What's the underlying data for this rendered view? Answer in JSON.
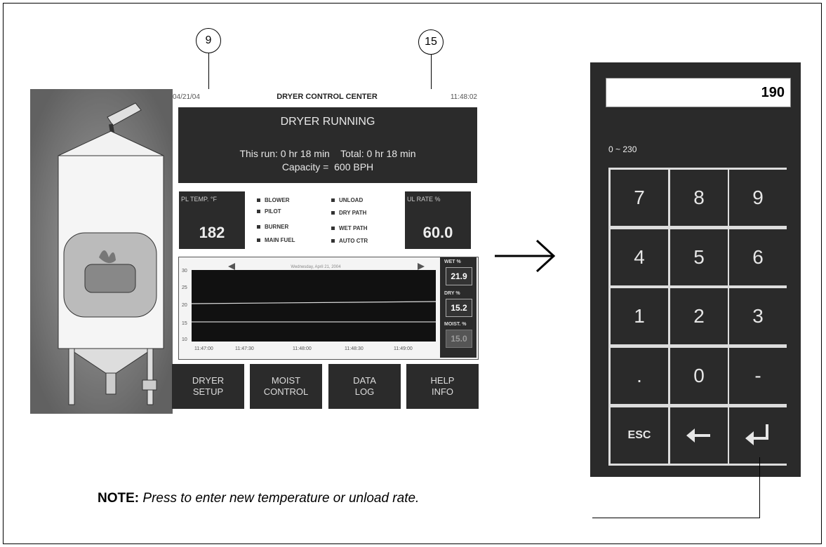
{
  "callouts": {
    "left": "9",
    "right": "15"
  },
  "hmi": {
    "date": "04/21/04",
    "title": "DRYER CONTROL CENTER",
    "time": "11:48:02",
    "status_line": "DRYER RUNNING",
    "run_line": "This run: 0 hr 18 min    Total: 0 hr 18 min",
    "capacity_line": "Capacity =  600 BPH",
    "temp_label": "PL TEMP. °F",
    "temp_value": "182",
    "rate_label": "UL RATE %",
    "rate_value": "60.0",
    "indicators_left": [
      "BLOWER",
      "PILOT",
      "BURNER",
      "MAIN FUEL"
    ],
    "indicators_right": [
      "UNLOAD",
      "DRY PATH",
      "WET PATH",
      "AUTO CTR"
    ],
    "chart": {
      "date_label": "Wednesday, April 21, 2004",
      "y_ticks": [
        "30",
        "25",
        "20",
        "15",
        "10"
      ],
      "x_ticks": [
        "11:47:00",
        "11:47:30",
        "11:48:00",
        "11:48:30",
        "11:49:00"
      ],
      "wet_label": "WET %",
      "wet_value": "21.9",
      "dry_label": "DRY %",
      "dry_value": "15.2",
      "set_label": "MOIST. %",
      "set_value": "15.0"
    },
    "buttons": [
      {
        "line1": "DRYER",
        "line2": "SETUP"
      },
      {
        "line1": "MOIST",
        "line2": "CONTROL"
      },
      {
        "line1": "DATA",
        "line2": "LOG"
      },
      {
        "line1": "HELP",
        "line2": "INFO"
      }
    ]
  },
  "keypad": {
    "display": "190",
    "range": "0 ~ 230",
    "keys": [
      "7",
      "8",
      "9",
      "4",
      "5",
      "6",
      "1",
      "2",
      "3",
      ".",
      "0",
      "-"
    ],
    "esc": "ESC"
  },
  "note": {
    "bold": "NOTE:",
    "text": "Press to enter new temperature or unload rate."
  }
}
